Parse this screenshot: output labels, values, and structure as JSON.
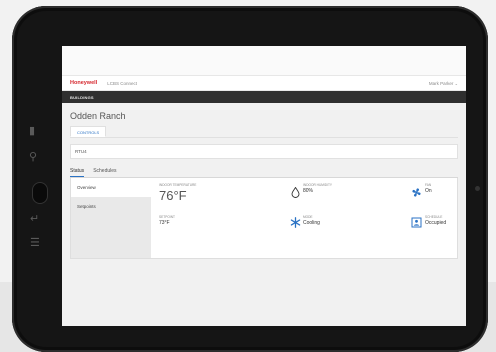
{
  "app": {
    "logo": "Honeywell",
    "name": "LCBS Connect",
    "user": "Mark Parker"
  },
  "nav": {
    "buildings": "BUILDINGS"
  },
  "page": {
    "title": "Odden Ranch",
    "subtab": "CONTROLS",
    "device": "RTU4"
  },
  "tabs": {
    "status": "Status",
    "schedules": "Schedules"
  },
  "left_nav": {
    "overview": "Overview",
    "setpoints": "Setpoints"
  },
  "metrics": {
    "indoor_temp": {
      "label": "INDOOR TEMPERATURE",
      "value": "76°F"
    },
    "indoor_humidity": {
      "label": "INDOOR HUMIDITY",
      "value": "80%"
    },
    "fan": {
      "label": "FAN",
      "value": "On"
    },
    "setpoint": {
      "label": "SETPOINT",
      "value": "73°F"
    },
    "mode": {
      "label": "MODE",
      "value": "Cooling"
    },
    "schedule": {
      "label": "SCHEDULE",
      "value": "Occupied"
    }
  },
  "icons": {
    "humidity": "drop-icon",
    "fan": "fan-icon",
    "mode": "snowflake-icon",
    "schedule": "schedule-icon"
  },
  "colors": {
    "brand_red": "#d6282f",
    "accent_blue": "#2a72c4",
    "nav_dark": "#2f2f2f"
  }
}
